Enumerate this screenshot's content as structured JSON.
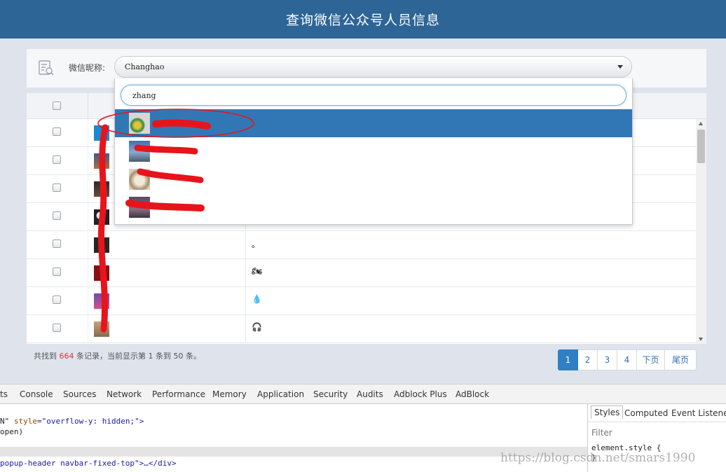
{
  "header": {
    "title": "查询微信公众号人员信息"
  },
  "search": {
    "label": "微信昵称:",
    "selected_value": "Changhao"
  },
  "dropdown": {
    "query": "zhang",
    "items": [
      {
        "selected": true
      },
      {
        "selected": false
      },
      {
        "selected": false
      },
      {
        "selected": false
      }
    ]
  },
  "table": {
    "rows": [
      {
        "nickname": ""
      },
      {
        "nickname": ""
      },
      {
        "nickname": ""
      },
      {
        "nickname": ""
      },
      {
        "nickname": "。"
      },
      {
        "nickname": "🏍"
      },
      {
        "nickname": "💧"
      },
      {
        "nickname": "🎧"
      }
    ]
  },
  "footer": {
    "records_prefix": "共找到",
    "records_count": "664",
    "records_suffix": "条记录，当前显示第 1 条到 50 条。"
  },
  "pagination": [
    "1",
    "2",
    "3",
    "4",
    "下页",
    "尾页"
  ],
  "devtools": {
    "tabs": [
      "ts",
      "Console",
      "Sources",
      "Network",
      "Performance",
      "Memory",
      "Application",
      "Security",
      "Audits",
      "Adblock Plus",
      "AdBlock"
    ],
    "line1_a": "N\" ",
    "line1_attr": "style",
    "line1_val": "=\"overflow-y: hidden;\">",
    "line2": "open)",
    "line3": "popup-header navbar-fixed-top\">…</div>",
    "side_tabs": [
      "Styles",
      "Computed",
      "Event Listeners"
    ],
    "filter": "Filter",
    "rule_open": "element.style {",
    "rule_close": "}"
  },
  "watermark": "https://blog.csdn.net/smars1990",
  "colors": {
    "header": "#2d6597",
    "selected_item": "#3277b5",
    "active_page": "#2f7fc4",
    "markup_red": "#e8141c"
  }
}
